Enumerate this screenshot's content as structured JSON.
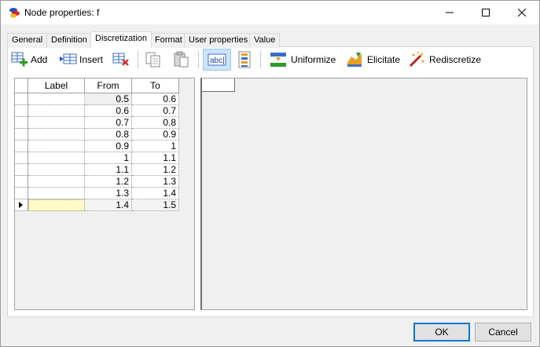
{
  "window": {
    "title": "Node properties: f"
  },
  "tabs": [
    {
      "label": "General"
    },
    {
      "label": "Definition"
    },
    {
      "label": "Discretization"
    },
    {
      "label": "Format"
    },
    {
      "label": "User properties"
    },
    {
      "label": "Value"
    }
  ],
  "active_tab": "Discretization",
  "toolbar": {
    "add_label": "Add",
    "insert_label": "Insert",
    "uniformize_label": "Uniformize",
    "elicitate_label": "Elicitate",
    "rediscretize_label": "Rediscretize",
    "toggle_label": "abc|"
  },
  "grid": {
    "columns": [
      "Label",
      "From",
      "To"
    ],
    "rows": [
      {
        "label": "",
        "from": "0.5",
        "to": "0.6"
      },
      {
        "label": "",
        "from": "0.6",
        "to": "0.7"
      },
      {
        "label": "",
        "from": "0.7",
        "to": "0.8"
      },
      {
        "label": "",
        "from": "0.8",
        "to": "0.9"
      },
      {
        "label": "",
        "from": "0.9",
        "to": "1"
      },
      {
        "label": "",
        "from": "1",
        "to": "1.1"
      },
      {
        "label": "",
        "from": "1.1",
        "to": "1.2"
      },
      {
        "label": "",
        "from": "1.2",
        "to": "1.3"
      },
      {
        "label": "",
        "from": "1.3",
        "to": "1.4"
      },
      {
        "label": "",
        "from": "1.4",
        "to": "1.5"
      }
    ]
  },
  "buttons": {
    "ok": "OK",
    "cancel": "Cancel"
  },
  "colors": {
    "accent": "#0078d7",
    "selected_cell": "#fffbc8",
    "toggle_bg": "#cce4f7"
  }
}
